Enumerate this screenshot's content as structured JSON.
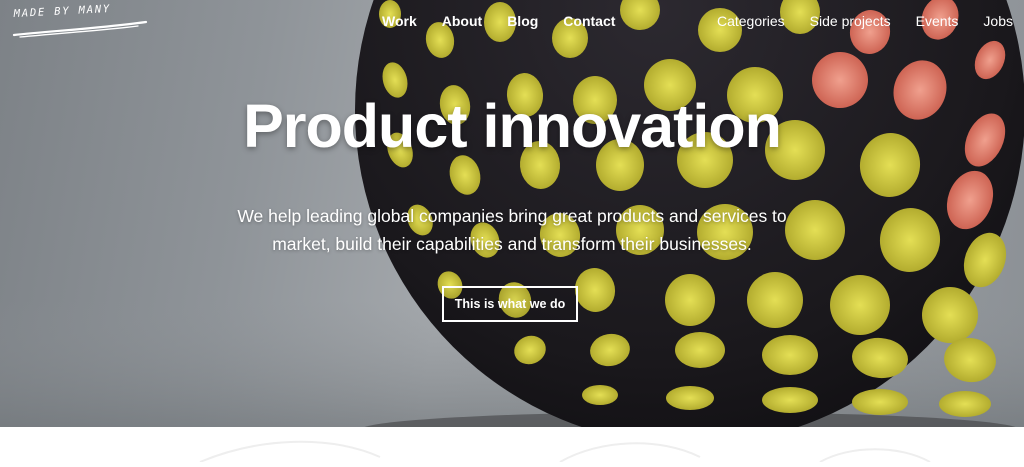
{
  "logo": {
    "text": "MADE BY MANY"
  },
  "nav": {
    "primary": [
      "Work",
      "About",
      "Blog",
      "Contact"
    ],
    "secondary": [
      "Categories",
      "Side projects",
      "Events",
      "Jobs"
    ]
  },
  "hero": {
    "headline": "Product innovation",
    "subline_1": "We help leading global companies bring great products and services to",
    "subline_2": "market, build their capabilities and transform their businesses.",
    "cta": "This is what we do"
  },
  "colors": {
    "sphere": "#1e1b20",
    "hole_yellow": "#c9c23a",
    "hole_red": "#e07a6a",
    "background_grey": "#a4a8ac"
  }
}
